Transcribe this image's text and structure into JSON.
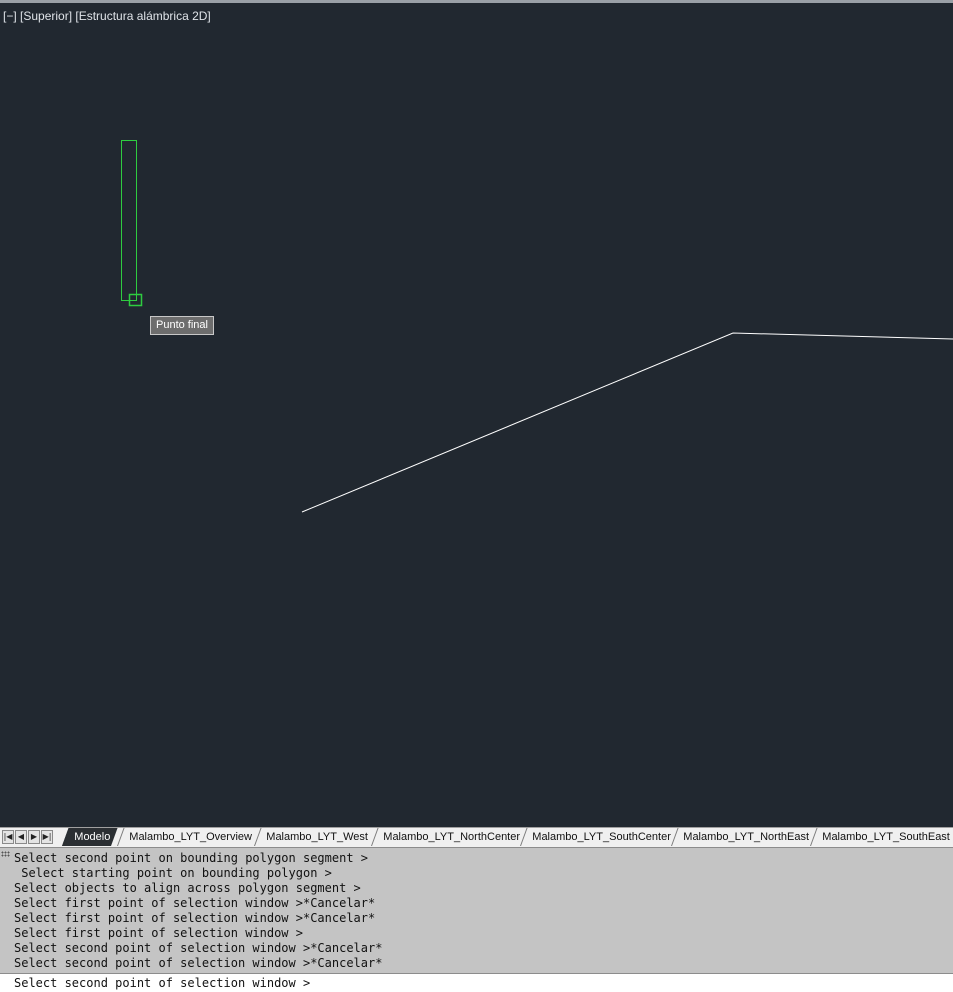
{
  "viewport": {
    "label": "[−] [Superior] [Estructura alámbrica 2D]",
    "snap_tooltip": "Punto final"
  },
  "colors": {
    "canvas": "#212830",
    "selected_object": "#2ecc40",
    "polyline": "#ffffff"
  },
  "tabbar": {
    "nav_buttons": [
      "first-icon",
      "prev-icon",
      "next-icon",
      "last-icon"
    ],
    "tabs": [
      {
        "label": "Modelo",
        "active": true
      },
      {
        "label": "Malambo_LYT_Overview",
        "active": false
      },
      {
        "label": "Malambo_LYT_West",
        "active": false
      },
      {
        "label": "Malambo_LYT_NorthCenter",
        "active": false
      },
      {
        "label": "Malambo_LYT_SouthCenter",
        "active": false
      },
      {
        "label": "Malambo_LYT_NorthEast",
        "active": false
      },
      {
        "label": "Malambo_LYT_SouthEast",
        "active": false
      }
    ]
  },
  "command": {
    "history": [
      "Select second point on bounding polygon segment >",
      " Select starting point on bounding polygon >",
      "Select objects to align across polygon segment >",
      "Select first point of selection window >*Cancelar*",
      "Select first point of selection window >*Cancelar*",
      "Select first point of selection window >",
      "Select second point of selection window >*Cancelar*",
      "Select second point of selection window >*Cancelar*"
    ],
    "prompt": "Select second point of selection window >"
  }
}
